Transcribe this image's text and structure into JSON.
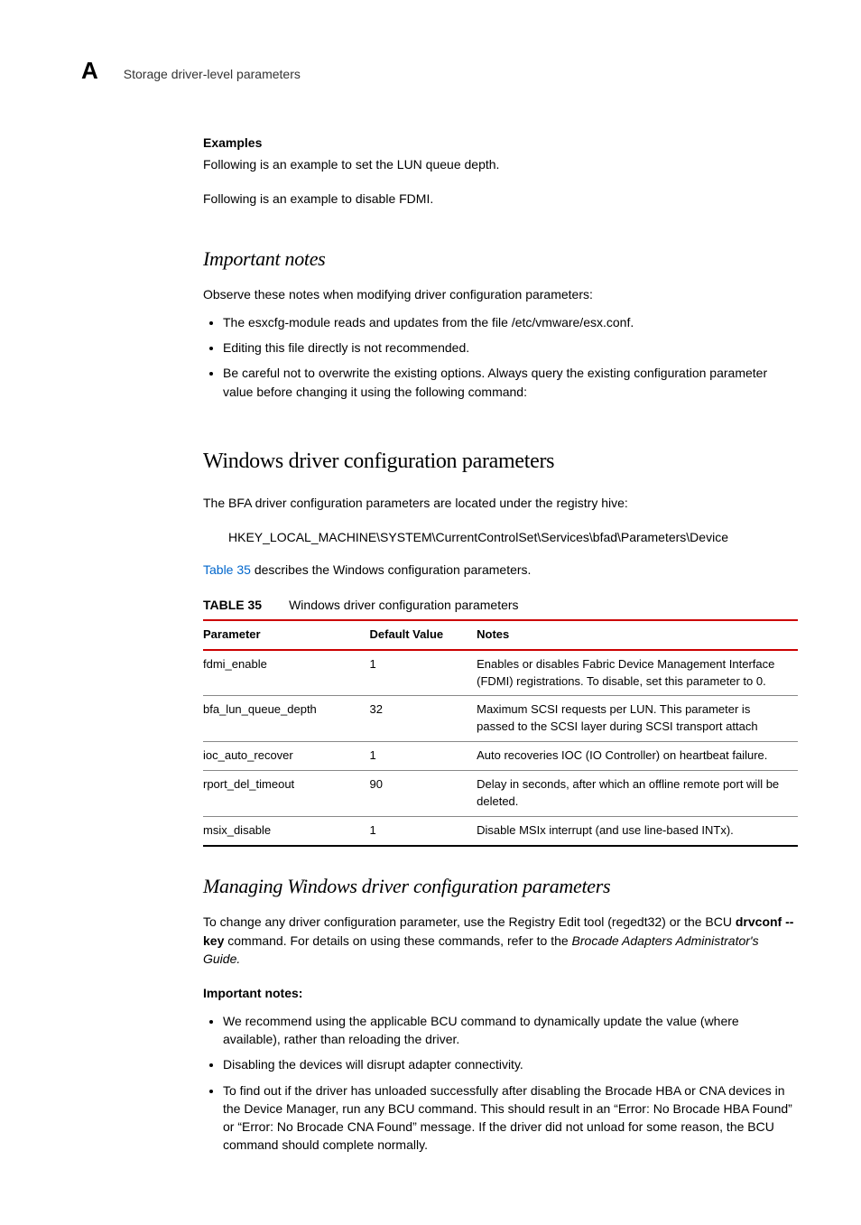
{
  "header": {
    "appendix_letter": "A",
    "running_title": "Storage driver-level parameters"
  },
  "examples": {
    "label": "Examples",
    "line1": "Following is an example to set the LUN queue depth.",
    "line2": "Following is an example to disable FDMI."
  },
  "important_notes_1": {
    "title": "Important notes",
    "intro": "Observe these notes when modifying driver configuration parameters:",
    "bullets": [
      "The esxcfg-module reads and updates from the file /etc/vmware/esx.conf.",
      "Editing this file directly is not recommended.",
      "Be careful not to overwrite the existing options. Always query the existing configuration parameter value before changing it using the following command:"
    ]
  },
  "windows": {
    "title": "Windows driver configuration parameters",
    "intro": "The BFA driver configuration parameters are located under the registry hive:",
    "registry_path": "HKEY_LOCAL_MACHINE\\SYSTEM\\CurrentControlSet\\Services\\bfad\\Parameters\\Device",
    "table_ref_link": "Table 35",
    "table_ref_rest": " describes the Windows configuration parameters.",
    "table_label_prefix": "TABLE 35",
    "table_label_title": "Windows driver configuration parameters"
  },
  "chart_data": {
    "type": "table",
    "columns": [
      "Parameter",
      "Default Value",
      "Notes"
    ],
    "rows": [
      {
        "parameter": "fdmi_enable",
        "default": "1",
        "notes": "Enables or disables Fabric Device Management Interface (FDMI) registrations. To disable, set this parameter to 0."
      },
      {
        "parameter": "bfa_lun_queue_depth",
        "default": "32",
        "notes": "Maximum SCSI requests per LUN. This parameter is passed to the SCSI layer during SCSI transport attach"
      },
      {
        "parameter": "ioc_auto_recover",
        "default": "1",
        "notes": "Auto recoveries IOC (IO Controller) on heartbeat failure."
      },
      {
        "parameter": "rport_del_timeout",
        "default": "90",
        "notes": "Delay in seconds, after which an offline remote port will be deleted."
      },
      {
        "parameter": "msix_disable",
        "default": "1",
        "notes": "Disable MSIx interrupt (and use line-based INTx)."
      }
    ]
  },
  "managing": {
    "title": "Managing Windows driver configuration parameters",
    "para_pre": "To change any driver configuration parameter, use the Registry Edit tool (regedt32) or the BCU ",
    "para_bold": "drvconf --key",
    "para_mid": " command. For details on using these commands, refer to the ",
    "para_italic": "Brocade Adapters Administrator's Guide.",
    "notes_label": "Important notes:",
    "bullets": [
      "We recommend using the applicable BCU command to dynamically update the value (where available), rather than reloading the driver.",
      "Disabling the devices will disrupt adapter connectivity.",
      "To find out if the driver has unloaded successfully after disabling the Brocade HBA or CNA devices in the Device Manager, run any BCU command. This should result in an “Error: No Brocade HBA Found” or “Error: No Brocade CNA Found” message. If the driver did not unload for some reason, the BCU command should complete normally."
    ]
  }
}
